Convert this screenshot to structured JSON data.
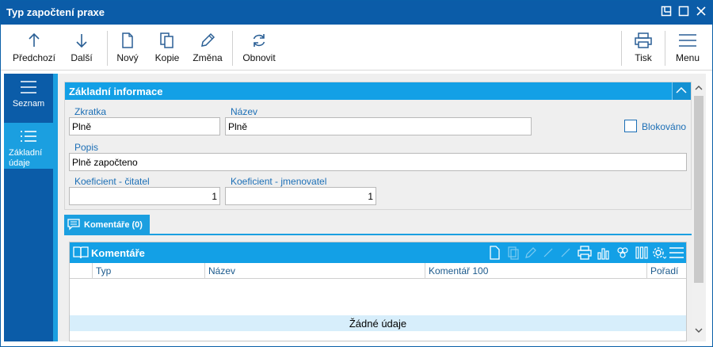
{
  "window": {
    "title": "Typ započtení praxe"
  },
  "toolbar": {
    "prev": "Předchozí",
    "next": "Další",
    "new": "Nový",
    "copy": "Kopie",
    "change": "Změna",
    "refresh": "Obnovit",
    "print": "Tisk",
    "menu": "Menu"
  },
  "nav": {
    "list": "Seznam",
    "basic_line1": "Základní",
    "basic_line2": "údaje"
  },
  "basic": {
    "header": "Základní informace",
    "abbr_label": "Zkratka",
    "abbr_value": "Plně",
    "name_label": "Název",
    "name_value": "Plně",
    "blocked_label": "Blokováno",
    "desc_label": "Popis",
    "desc_value": "Plně započteno",
    "num_label": "Koeficient - čitatel",
    "num_value": "1",
    "den_label": "Koeficient - jmenovatel",
    "den_value": "1"
  },
  "tabs": {
    "comments": "Komentáře (0)"
  },
  "comments": {
    "header": "Komentáře",
    "columns": [
      "Typ",
      "Název",
      "Komentář 100",
      "Pořadí"
    ],
    "empty": "Žádné údaje"
  },
  "colors": {
    "titlebar": "#0b5ca8",
    "accent": "#1b9fe0",
    "label": "#1c6fb6"
  }
}
